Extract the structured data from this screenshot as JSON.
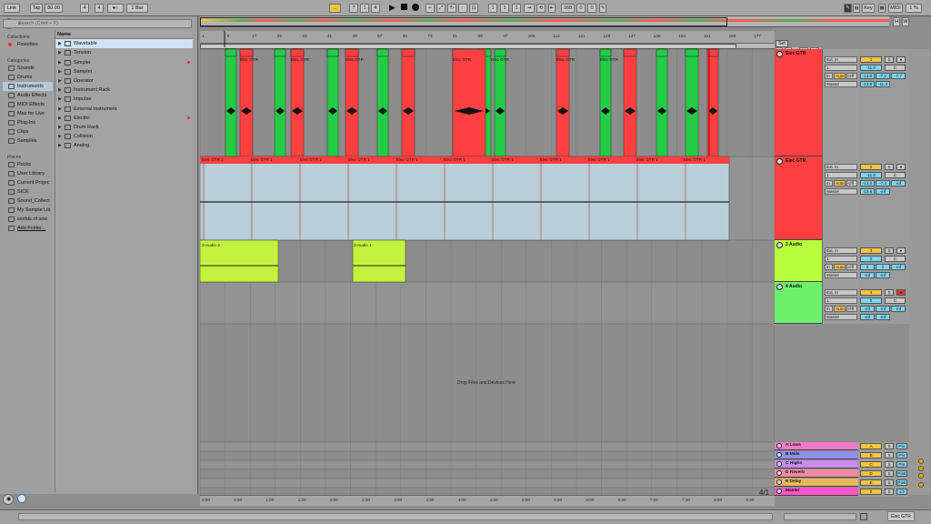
{
  "topbar": {
    "link": "Link",
    "tap": "Tap",
    "tempo": "80.00",
    "sig_num": "4",
    "sig_den": "4",
    "metro": "1 Bar",
    "pos": [
      "7",
      "1",
      "4"
    ],
    "loop_pos": [
      "1",
      "1",
      "1"
    ],
    "loop_len": [
      "168",
      "0",
      "0"
    ],
    "key": "Key",
    "midi": "MIDI",
    "cpu": "1 %"
  },
  "browser": {
    "search_placeholder": "Search (Cmd + F)",
    "collections_header": "Collections",
    "favorites": "Favorites",
    "categories_header": "Categories",
    "categories": [
      "Sounds",
      "Drums",
      "Instruments",
      "Audio Effects",
      "MIDI Effects",
      "Max for Live",
      "Plug-Ins",
      "Clips",
      "Samples"
    ],
    "places_header": "Places",
    "places": [
      "Packs",
      "User Library",
      "Current Projec",
      "SICK",
      "Sound_Collect",
      "My Sample Lib",
      "worlds of sow",
      "Add Folder..."
    ],
    "name_header": "Name",
    "items": [
      "Wavetable",
      "Tension",
      "Simpler",
      "Sampler",
      "Operator",
      "Instrument Rack",
      "Impulse",
      "External Instrument",
      "Electric",
      "Drum Rack",
      "Collision",
      "Analog"
    ]
  },
  "ruler": {
    "bars": [
      "1",
      "9",
      "17",
      "25",
      "33",
      "41",
      "49",
      "57",
      "65",
      "73",
      "81",
      "89",
      "97",
      "105",
      "113",
      "121",
      "129",
      "137",
      "145",
      "153",
      "161",
      "169",
      "177"
    ],
    "set": "Set"
  },
  "tracks": [
    {
      "name": "Elec GTR",
      "color": "#ff4040",
      "input": "Ext. In",
      "chan": "1",
      "monitor_in": "In",
      "monitor_auto": "Auto",
      "monitor_off": "Off",
      "out": "Master",
      "num": "1",
      "vol": "-11.0",
      "pan": "C",
      "sa": "-13.0",
      "sb": "-7.3",
      "sc": "-7.7",
      "sd": "-13.8",
      "se": "-11.4"
    },
    {
      "name": "Elec GTR",
      "color": "#ff4040",
      "input": "Ext. In",
      "chan": "1",
      "monitor_in": "In",
      "monitor_auto": "Auto",
      "monitor_off": "Off",
      "out": "Master",
      "num": "2",
      "vol": "-11.0",
      "pan": "C",
      "sa": "-13.0",
      "sb": "-7.3",
      "sc": "-inf",
      "sd": "-13.6",
      "se": "-inf"
    },
    {
      "name": "3 Audio",
      "color": "#b9ff3c",
      "input": "Ext. In",
      "chan": "1",
      "monitor_in": "In",
      "monitor_auto": "Auto",
      "monitor_off": "Off",
      "out": "Master",
      "num": "3",
      "vol": "0",
      "pan": "C",
      "sa": "0",
      "sb": "0",
      "sc": "-inf",
      "sd": "-inf",
      "se": "-inf"
    },
    {
      "name": "4 Audio",
      "color": "#6cf06c",
      "input": "Ext. In",
      "chan": "1",
      "monitor_in": "In",
      "monitor_auto": "Auto",
      "monitor_off": "Off",
      "out": "Master",
      "num": "4",
      "vol": "0",
      "pan": "C",
      "sa": "-inf",
      "sb": "-inf",
      "sc": "-inf",
      "sd": "-inf",
      "se": "-inf"
    }
  ],
  "clips": {
    "gtr1": "Elec GTR",
    "gtr2": "Elec GTR 1",
    "aud3": "3-Audio 3",
    "aud3b": "3-Audio 1"
  },
  "drop_text": "Drop Files and Devices Here",
  "returns": [
    {
      "name": "A Lows",
      "color": "#f07ac8",
      "letter": "A",
      "mode": "Pre"
    },
    {
      "name": "B Mids",
      "color": "#8f8ff0",
      "letter": "B",
      "mode": "Pre"
    },
    {
      "name": "C Highs",
      "color": "#c78af0",
      "letter": "C",
      "mode": "Pre"
    },
    {
      "name": "D Reverb",
      "color": "#f08aa0",
      "letter": "D",
      "mode": "Post"
    },
    {
      "name": "E Delay",
      "color": "#e8b85a",
      "letter": "E",
      "mode": "Post"
    },
    {
      "name": "Master",
      "color": "#ff55c8",
      "letter": "0",
      "mode": "1/2"
    }
  ],
  "timeline": {
    "times": [
      "0:00",
      "0:30",
      "1:00",
      "1:30",
      "2:00",
      "2:30",
      "3:00",
      "3:30",
      "4:00",
      "4:30",
      "5:00",
      "5:30",
      "6:00",
      "6:30",
      "7:00",
      "7:30",
      "8:00",
      "8:30"
    ],
    "zoom": "4/1"
  },
  "status": {
    "track": "Elec GTR"
  }
}
